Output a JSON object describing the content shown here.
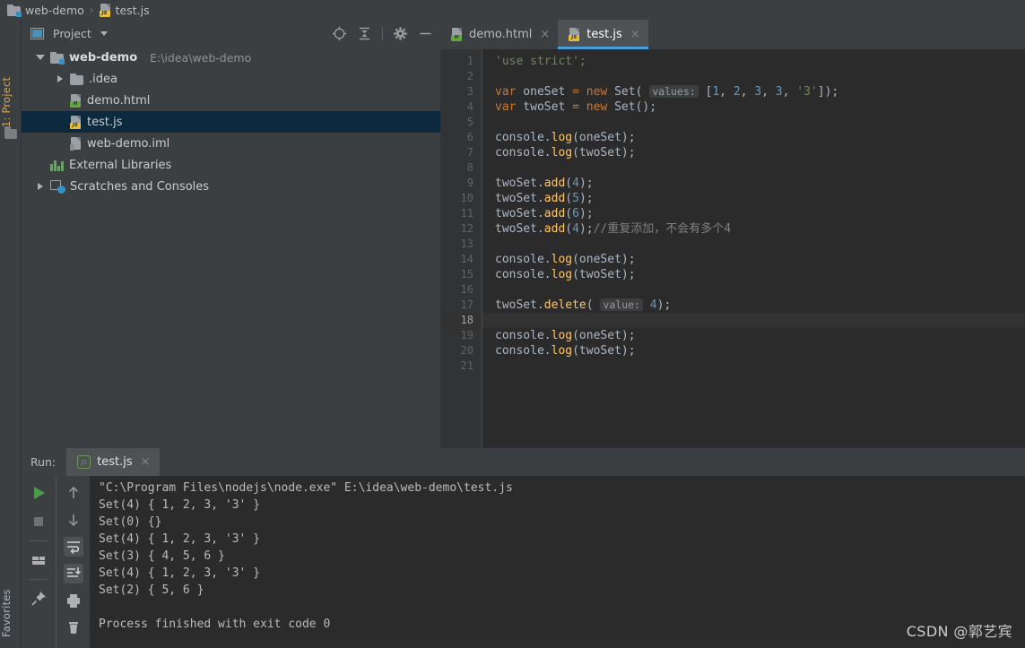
{
  "navbar": {
    "project_name": "web-demo",
    "separator": "›",
    "file_name": "test.js"
  },
  "project_panel": {
    "title": "Project",
    "icons": [
      "locate-crosshair-icon",
      "collapse-all-icon",
      "settings-gear-icon",
      "minimize-icon"
    ],
    "tree": [
      {
        "label": "web-demo",
        "path": "E:\\idea\\web-demo",
        "icon": "folder-module-icon",
        "depth": 0,
        "arrow": "open",
        "selected": false,
        "bold": true
      },
      {
        "label": ".idea",
        "path": "",
        "icon": "folder-icon",
        "depth": 1,
        "arrow": "closed",
        "selected": false,
        "bold": false
      },
      {
        "label": "demo.html",
        "path": "",
        "icon": "html-file-icon",
        "depth": 1,
        "arrow": "none",
        "selected": false,
        "bold": false
      },
      {
        "label": "test.js",
        "path": "",
        "icon": "js-file-icon",
        "depth": 1,
        "arrow": "none",
        "selected": true,
        "bold": false
      },
      {
        "label": "web-demo.iml",
        "path": "",
        "icon": "iml-file-icon",
        "depth": 1,
        "arrow": "none",
        "selected": false,
        "bold": false
      },
      {
        "label": "External Libraries",
        "path": "",
        "icon": "libraries-icon",
        "depth": 0,
        "arrow": "none",
        "selected": false,
        "bold": false
      },
      {
        "label": "Scratches and Consoles",
        "path": "",
        "icon": "scratches-icon",
        "depth": 0,
        "arrow": "closed",
        "selected": false,
        "bold": false
      }
    ]
  },
  "left_strip": {
    "project_tab": "1: Project",
    "favorites_tab": "Favorites"
  },
  "editor": {
    "tabs": [
      {
        "label": "demo.html",
        "icon": "html-file-icon",
        "active": false,
        "close": "×"
      },
      {
        "label": "test.js",
        "icon": "js-file-icon",
        "active": true,
        "close": "×"
      }
    ],
    "current_line": 18,
    "line_count": 21,
    "lines": [
      {
        "num": 1,
        "tokens": [
          {
            "t": "'use strict';",
            "c": "s"
          }
        ]
      },
      {
        "num": 2,
        "tokens": []
      },
      {
        "num": 3,
        "tokens": [
          {
            "t": "var",
            "c": "k"
          },
          {
            "t": " oneSet ",
            "c": "id"
          },
          {
            "t": "=",
            "c": "k"
          },
          {
            "t": " ",
            "c": "id"
          },
          {
            "t": "new",
            "c": "k"
          },
          {
            "t": " Set( ",
            "c": "id"
          },
          {
            "t": "values:",
            "c": "hint"
          },
          {
            "t": " [",
            "c": "id"
          },
          {
            "t": "1",
            "c": "n"
          },
          {
            "t": ", ",
            "c": "id"
          },
          {
            "t": "2",
            "c": "n"
          },
          {
            "t": ", ",
            "c": "id"
          },
          {
            "t": "3",
            "c": "n"
          },
          {
            "t": ", ",
            "c": "id"
          },
          {
            "t": "3",
            "c": "n"
          },
          {
            "t": ", ",
            "c": "id"
          },
          {
            "t": "'3'",
            "c": "s"
          },
          {
            "t": "]);",
            "c": "id"
          }
        ]
      },
      {
        "num": 4,
        "tokens": [
          {
            "t": "var",
            "c": "k"
          },
          {
            "t": " twoSet ",
            "c": "id"
          },
          {
            "t": "=",
            "c": "k"
          },
          {
            "t": " ",
            "c": "id"
          },
          {
            "t": "new",
            "c": "k"
          },
          {
            "t": " Set();",
            "c": "id"
          }
        ]
      },
      {
        "num": 5,
        "tokens": []
      },
      {
        "num": 6,
        "tokens": [
          {
            "t": "console.",
            "c": "id"
          },
          {
            "t": "log",
            "c": "fn"
          },
          {
            "t": "(oneSet);",
            "c": "id"
          }
        ]
      },
      {
        "num": 7,
        "tokens": [
          {
            "t": "console.",
            "c": "id"
          },
          {
            "t": "log",
            "c": "fn"
          },
          {
            "t": "(twoSet);",
            "c": "id"
          }
        ]
      },
      {
        "num": 8,
        "tokens": []
      },
      {
        "num": 9,
        "tokens": [
          {
            "t": "twoSet.",
            "c": "id"
          },
          {
            "t": "add",
            "c": "fn"
          },
          {
            "t": "(",
            "c": "id"
          },
          {
            "t": "4",
            "c": "n"
          },
          {
            "t": ");",
            "c": "id"
          }
        ]
      },
      {
        "num": 10,
        "tokens": [
          {
            "t": "twoSet.",
            "c": "id"
          },
          {
            "t": "add",
            "c": "fn"
          },
          {
            "t": "(",
            "c": "id"
          },
          {
            "t": "5",
            "c": "n"
          },
          {
            "t": ");",
            "c": "id"
          }
        ]
      },
      {
        "num": 11,
        "tokens": [
          {
            "t": "twoSet.",
            "c": "id"
          },
          {
            "t": "add",
            "c": "fn"
          },
          {
            "t": "(",
            "c": "id"
          },
          {
            "t": "6",
            "c": "n"
          },
          {
            "t": ");",
            "c": "id"
          }
        ]
      },
      {
        "num": 12,
        "tokens": [
          {
            "t": "twoSet.",
            "c": "id"
          },
          {
            "t": "add",
            "c": "fn"
          },
          {
            "t": "(",
            "c": "id"
          },
          {
            "t": "4",
            "c": "n"
          },
          {
            "t": ");",
            "c": "id"
          },
          {
            "t": "//重复添加，不会有多个4",
            "c": "cm"
          }
        ]
      },
      {
        "num": 13,
        "tokens": []
      },
      {
        "num": 14,
        "tokens": [
          {
            "t": "console.",
            "c": "id"
          },
          {
            "t": "log",
            "c": "fn"
          },
          {
            "t": "(oneSet);",
            "c": "id"
          }
        ]
      },
      {
        "num": 15,
        "tokens": [
          {
            "t": "console.",
            "c": "id"
          },
          {
            "t": "log",
            "c": "fn"
          },
          {
            "t": "(twoSet);",
            "c": "id"
          }
        ]
      },
      {
        "num": 16,
        "tokens": []
      },
      {
        "num": 17,
        "tokens": [
          {
            "t": "twoSet.",
            "c": "id"
          },
          {
            "t": "delete",
            "c": "fn"
          },
          {
            "t": "( ",
            "c": "id"
          },
          {
            "t": "value:",
            "c": "hint"
          },
          {
            "t": " ",
            "c": "id"
          },
          {
            "t": "4",
            "c": "n"
          },
          {
            "t": ");",
            "c": "id"
          }
        ]
      },
      {
        "num": 18,
        "tokens": []
      },
      {
        "num": 19,
        "tokens": [
          {
            "t": "console.",
            "c": "id"
          },
          {
            "t": "log",
            "c": "fn"
          },
          {
            "t": "(oneSet);",
            "c": "id"
          }
        ]
      },
      {
        "num": 20,
        "tokens": [
          {
            "t": "console.",
            "c": "id"
          },
          {
            "t": "log",
            "c": "fn"
          },
          {
            "t": "(twoSet);",
            "c": "id"
          }
        ]
      },
      {
        "num": 21,
        "tokens": []
      }
    ]
  },
  "run_panel": {
    "label": "Run:",
    "tab_label": "test.js",
    "tab_close": "×",
    "left_tools": [
      "run-icon",
      "stop-icon",
      "restore-layout-icon",
      "pin-tab-icon"
    ],
    "right_tools": [
      "up-arrow-icon",
      "down-arrow-icon",
      "soft-wrap-icon",
      "scroll-to-end-icon",
      "print-icon",
      "clear-all-icon"
    ],
    "console_lines": [
      "\"C:\\Program Files\\nodejs\\node.exe\" E:\\idea\\web-demo\\test.js",
      "Set(4) { 1, 2, 3, '3' }",
      "Set(0) {}",
      "Set(4) { 1, 2, 3, '3' }",
      "Set(3) { 4, 5, 6 }",
      "Set(4) { 1, 2, 3, '3' }",
      "Set(2) { 5, 6 }",
      "",
      "Process finished with exit code 0"
    ]
  },
  "watermark": "CSDN @郭艺宾",
  "colors": {
    "panel_bg": "#3c3f41",
    "editor_bg": "#2b2b2b",
    "gutter_bg": "#313335",
    "selection_bg": "#0d293e",
    "tab_active_bg": "#4e5254",
    "tab_underline": "#4a9ddb",
    "keyword": "#cc7832",
    "string": "#6a8759",
    "number": "#6897bb",
    "function": "#ffc66d",
    "comment": "#808080",
    "plain_text": "#a9b7c6",
    "run_green": "#4a9c4a"
  }
}
